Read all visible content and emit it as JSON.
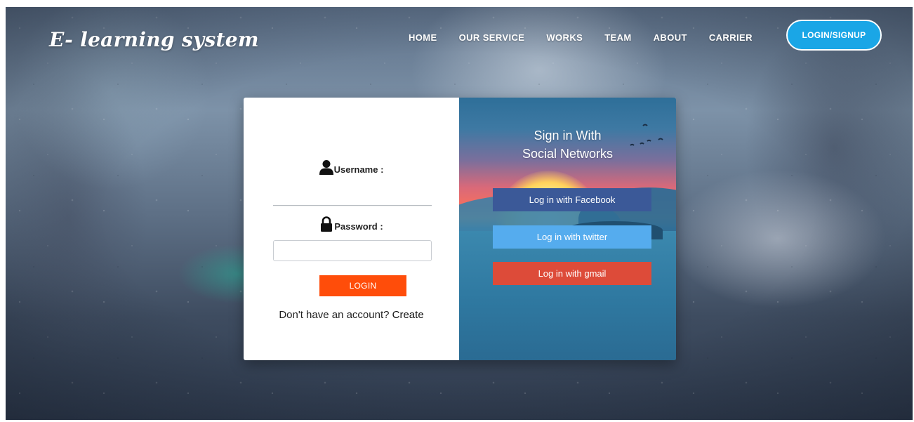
{
  "brand": {
    "name": "E- learning system"
  },
  "nav": {
    "items": [
      {
        "label": "HOME"
      },
      {
        "label": "OUR SERVICE"
      },
      {
        "label": "WORKS"
      },
      {
        "label": "TEAM"
      },
      {
        "label": "ABOUT"
      },
      {
        "label": "CARRIER"
      }
    ],
    "cta": "LOGIN/SIGNUP"
  },
  "login": {
    "username_label": "Username :",
    "username_value": "",
    "password_label": "Password :",
    "password_value": "",
    "submit_label": "LOGIN",
    "signup_prompt": "Don't have an account?",
    "signup_link": "Create"
  },
  "social": {
    "title_line1": "Sign in With",
    "title_line2": "Social Networks",
    "facebook_label": "Log in with Facebook",
    "twitter_label": "Log in with twitter",
    "gmail_label": "Log in with gmail"
  },
  "colors": {
    "cta": "#1aa6e6",
    "login_button": "#ff4d0a",
    "facebook": "#3b5998",
    "twitter": "#55acee",
    "gmail": "#dd4b39"
  },
  "icons": {
    "username": "user-icon",
    "password": "lock-icon"
  }
}
